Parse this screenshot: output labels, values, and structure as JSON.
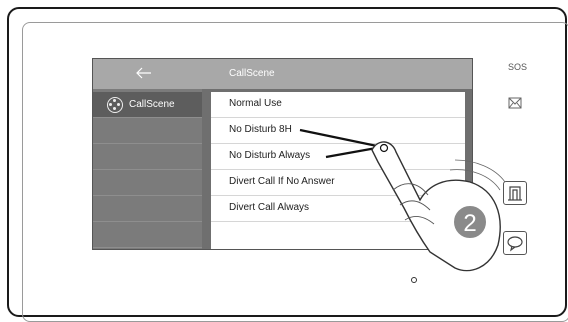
{
  "device": {
    "sos_label": "SOS"
  },
  "screen": {
    "title": "CallScene",
    "back_icon": "arrow-left-icon",
    "sidebar": {
      "items": [
        {
          "label": "CallScene",
          "icon": "scene-icon"
        }
      ]
    },
    "options": [
      {
        "label": "Normal Use"
      },
      {
        "label": "No Disturb 8H"
      },
      {
        "label": "No Disturb Always"
      },
      {
        "label": "Divert Call If No Answer"
      },
      {
        "label": "Divert Call Always"
      }
    ]
  },
  "annotation": {
    "step_number": "2"
  },
  "colors": {
    "screen_bg": "#6f6f6f",
    "header_bg": "#a8a8a8",
    "list_bg": "#ffffff",
    "badge": "#8a8a8a"
  }
}
